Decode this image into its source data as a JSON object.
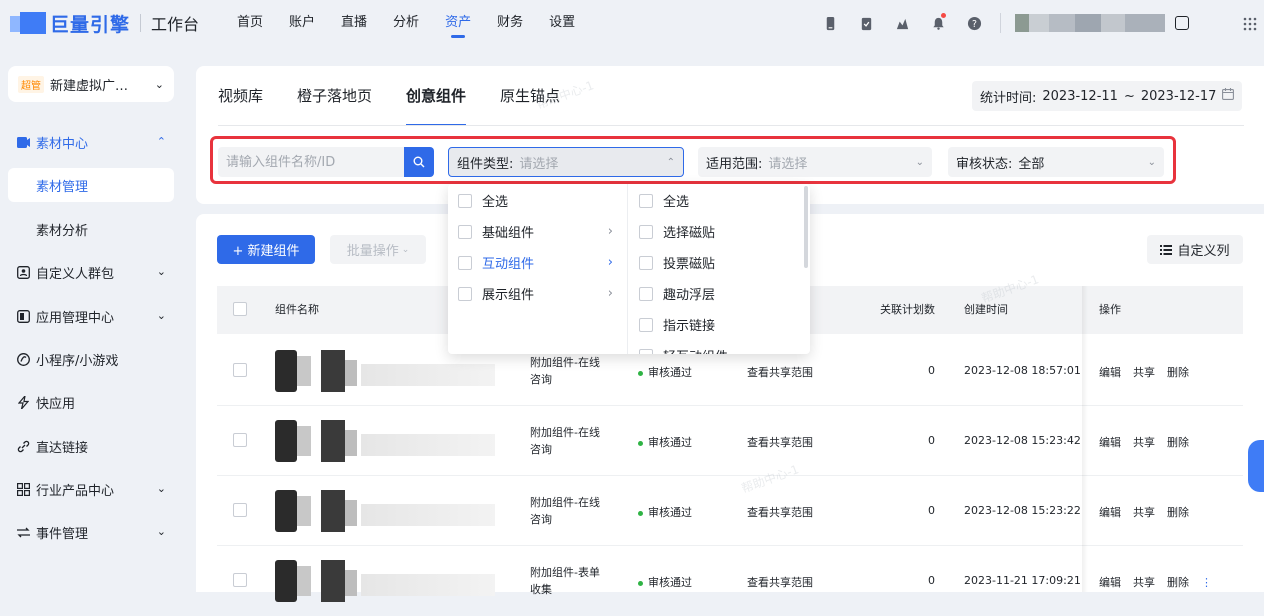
{
  "header": {
    "logo_text": "巨量引擎",
    "workspace": "工作台",
    "nav": [
      "首页",
      "账户",
      "直播",
      "分析",
      "资产",
      "财务",
      "设置"
    ],
    "active_nav": "资产"
  },
  "sidebar": {
    "account_tag": "超管",
    "account_name": "新建虚拟广…",
    "items": [
      {
        "label": "素材中心",
        "icon": "image-icon"
      },
      {
        "label": "素材管理"
      },
      {
        "label": "素材分析"
      },
      {
        "label": "自定义人群包",
        "icon": "audience-icon"
      },
      {
        "label": "应用管理中心",
        "icon": "app-icon"
      },
      {
        "label": "小程序/小游戏",
        "icon": "miniprogram-icon"
      },
      {
        "label": "快应用",
        "icon": "bolt-icon"
      },
      {
        "label": "直达链接",
        "icon": "link-icon"
      },
      {
        "label": "行业产品中心",
        "icon": "grid-icon"
      },
      {
        "label": "事件管理",
        "icon": "event-icon"
      }
    ]
  },
  "tabs": [
    "视频库",
    "橙子落地页",
    "创意组件",
    "原生锚点"
  ],
  "active_tab": "创意组件",
  "stats": {
    "label": "统计时间:",
    "start": "2023-12-11",
    "sep": "~",
    "end": "2023-12-17"
  },
  "filters": {
    "search_placeholder": "请输入组件名称/ID",
    "type_label": "组件类型:",
    "type_placeholder": "请选择",
    "scope_label": "适用范围:",
    "scope_placeholder": "请选择",
    "audit_label": "审核状态:",
    "audit_value": "全部"
  },
  "dropdown": {
    "col1": [
      "全选",
      "基础组件",
      "互动组件",
      "展示组件"
    ],
    "col1_active": "互动组件",
    "col2": [
      "全选",
      "选择磁贴",
      "投票磁贴",
      "趣动浮层",
      "指示链接",
      "轻互动组件"
    ]
  },
  "toolbar": {
    "new": "+ 新建组件",
    "batch": "批量操作",
    "custom_cols": "自定义列"
  },
  "table": {
    "headers": {
      "name": "组件名称",
      "plans": "关联计划数",
      "created": "创建时间",
      "ops": "操作"
    },
    "rows": [
      {
        "type": [
          "附加组件-在线",
          "咨询"
        ],
        "status": "审核通过",
        "scope": "查看共享范围",
        "plans": "0",
        "created": "2023-12-08 18:57:01"
      },
      {
        "type": [
          "附加组件-在线",
          "咨询"
        ],
        "status": "审核通过",
        "scope": "查看共享范围",
        "plans": "0",
        "created": "2023-12-08 15:23:42"
      },
      {
        "type": [
          "附加组件-在线",
          "咨询"
        ],
        "status": "审核通过",
        "scope": "查看共享范围",
        "plans": "0",
        "created": "2023-12-08 15:23:22"
      },
      {
        "type": [
          "附加组件-表单",
          "收集"
        ],
        "status": "审核通过",
        "scope": "查看共享范围",
        "plans": "0",
        "created": "2023-11-21 17:09:21"
      }
    ],
    "actions": [
      "编辑",
      "共享",
      "删除"
    ]
  },
  "watermark": "帮助中心-1",
  "colors": {
    "accent": "#2f6ae8",
    "highlight": "#e8333d",
    "success": "#2fb344"
  }
}
